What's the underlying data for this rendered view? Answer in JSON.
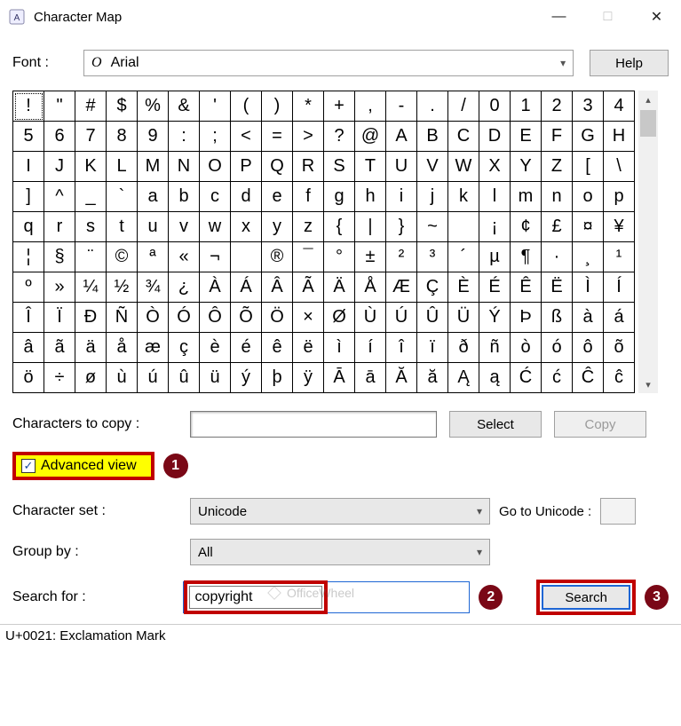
{
  "title": "Character Map",
  "font_label": "Font :",
  "font_value": "Arial",
  "help_label": "Help",
  "chars": [
    "!",
    "\"",
    "#",
    "$",
    "%",
    "&",
    "'",
    "(",
    ")",
    "*",
    "+",
    ",",
    "-",
    ".",
    "/",
    "0",
    "1",
    "2",
    "3",
    "4",
    "5",
    "6",
    "7",
    "8",
    "9",
    ":",
    ";",
    "<",
    "=",
    ">",
    "?",
    "@",
    "A",
    "B",
    "C",
    "D",
    "E",
    "F",
    "G",
    "H",
    "I",
    "J",
    "K",
    "L",
    "M",
    "N",
    "O",
    "P",
    "Q",
    "R",
    "S",
    "T",
    "U",
    "V",
    "W",
    "X",
    "Y",
    "Z",
    "[",
    "\\",
    "]",
    "^",
    "_",
    "`",
    "a",
    "b",
    "c",
    "d",
    "e",
    "f",
    "g",
    "h",
    "i",
    "j",
    "k",
    "l",
    "m",
    "n",
    "o",
    "p",
    "q",
    "r",
    "s",
    "t",
    "u",
    "v",
    "w",
    "x",
    "y",
    "z",
    "{",
    "|",
    "}",
    "~",
    "",
    "¡",
    "¢",
    "£",
    "¤",
    "¥",
    "¦",
    "§",
    "¨",
    "©",
    "ª",
    "«",
    "¬",
    "­",
    "®",
    "¯",
    "°",
    "±",
    "²",
    "³",
    "´",
    "µ",
    "¶",
    "·",
    "¸",
    "¹",
    "º",
    "»",
    "¼",
    "½",
    "¾",
    "¿",
    "À",
    "Á",
    "Â",
    "Ã",
    "Ä",
    "Å",
    "Æ",
    "Ç",
    "È",
    "É",
    "Ê",
    "Ë",
    "Ì",
    "Í",
    "Î",
    "Ï",
    "Ð",
    "Ñ",
    "Ò",
    "Ó",
    "Ô",
    "Õ",
    "Ö",
    "×",
    "Ø",
    "Ù",
    "Ú",
    "Û",
    "Ü",
    "Ý",
    "Þ",
    "ß",
    "à",
    "á",
    "â",
    "ã",
    "ä",
    "å",
    "æ",
    "ç",
    "è",
    "é",
    "ê",
    "ë",
    "ì",
    "í",
    "î",
    "ï",
    "ð",
    "ñ",
    "ò",
    "ó",
    "ô",
    "õ",
    "ö",
    "÷",
    "ø",
    "ù",
    "ú",
    "û",
    "ü",
    "ý",
    "þ",
    "ÿ",
    "Ā",
    "ā",
    "Ă",
    "ă",
    "Ą",
    "ą",
    "Ć",
    "ć",
    "Ĉ",
    "ĉ"
  ],
  "copy_label": "Characters to copy :",
  "select_label": "Select",
  "copy_btn_label": "Copy",
  "adv_label": "Advanced view",
  "charset_label": "Character set :",
  "charset_value": "Unicode",
  "gotounicode_label": "Go to Unicode :",
  "groupby_label": "Group by :",
  "groupby_value": "All",
  "searchfor_label": "Search for :",
  "search_value": "copyright",
  "search_btn_label": "Search",
  "status": "U+0021: Exclamation Mark",
  "badges": {
    "adv": "1",
    "search": "2",
    "btn": "3"
  },
  "watermark": "OfficeWheel"
}
